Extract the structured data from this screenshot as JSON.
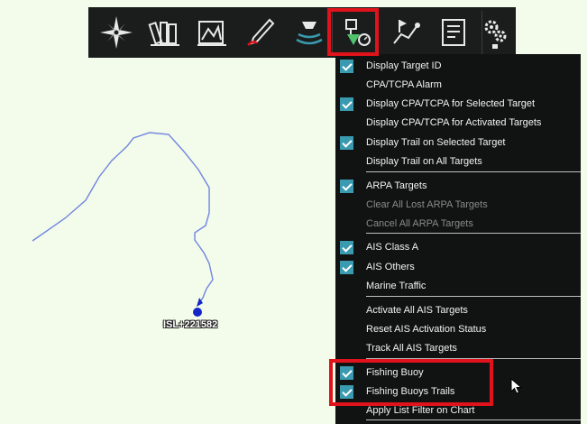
{
  "map": {
    "target_label": "ISL+221582"
  },
  "toolbar": {
    "buttons": [
      {
        "icon": "compass-rose-icon"
      },
      {
        "icon": "chart-books-icon"
      },
      {
        "icon": "chart-layers-icon"
      },
      {
        "icon": "route-pen-icon"
      },
      {
        "icon": "ship-radar-icon"
      },
      {
        "icon": "target-settings-icon",
        "active": true
      },
      {
        "icon": "waypoint-route-icon"
      },
      {
        "icon": "logbook-icon"
      },
      {
        "icon": "gears-icon"
      }
    ]
  },
  "menu": {
    "items": [
      {
        "label": "Display Target ID",
        "checked": true
      },
      {
        "label": "CPA/TCPA Alarm",
        "checked": false
      },
      {
        "label": "Display CPA/TCPA for Selected Target",
        "checked": true
      },
      {
        "label": "Display CPA/TCPA for Activated Targets",
        "checked": false
      },
      {
        "label": "Display Trail on Selected Target",
        "checked": true
      },
      {
        "label": "Display Trail on All Targets",
        "checked": false
      },
      {
        "label": "ARPA Targets",
        "checked": true
      },
      {
        "label": "Clear All Lost ARPA Targets",
        "checked": false,
        "disabled": true
      },
      {
        "label": "Cancel All ARPA Targets",
        "checked": false,
        "disabled": true
      },
      {
        "label": "AIS Class A",
        "checked": true
      },
      {
        "label": "AIS Others",
        "checked": true
      },
      {
        "label": "Marine Traffic",
        "checked": false
      },
      {
        "label": "Activate All AIS Targets",
        "checked": false
      },
      {
        "label": "Reset AIS Activation Status",
        "checked": false
      },
      {
        "label": "Track All AIS Targets",
        "checked": false
      },
      {
        "label": "Fishing Buoy",
        "checked": true
      },
      {
        "label": "Fishing Buoys Trails",
        "checked": true
      },
      {
        "label": "Apply List Filter on Chart",
        "checked": false
      }
    ]
  },
  "colors": {
    "highlight": "#e0121b",
    "checkbox": "#3a9ab0",
    "track": "#6f86e0",
    "target": "#1326c8"
  }
}
